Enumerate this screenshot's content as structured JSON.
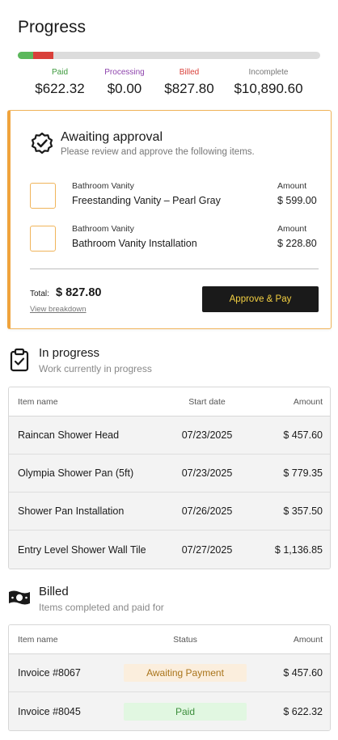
{
  "page": {
    "title": "Progress"
  },
  "progress": {
    "paid_fraction": 0.0505,
    "billed_fraction": 0.0672,
    "colors": {
      "paid": "#5cb85c",
      "billed": "#d9403a",
      "track": "#dcdcdc"
    },
    "stats": [
      {
        "label": "Paid",
        "value": "$622.32",
        "color": "#3d9a3d"
      },
      {
        "label": "Processing",
        "value": "$0.00",
        "color": "#8e44ad"
      },
      {
        "label": "Billed",
        "value": "$827.80",
        "color": "#d9403a"
      },
      {
        "label": "Incomplete",
        "value": "$10,890.60",
        "color": "#777777"
      }
    ]
  },
  "approval": {
    "icon": "badge-check-icon",
    "title": "Awaiting approval",
    "subtitle": "Please review and approve the following items.",
    "items": [
      {
        "category": "Bathroom Vanity",
        "name": "Freestanding Vanity – Pearl Gray",
        "amount_label": "Amount",
        "amount": "$ 599.00"
      },
      {
        "category": "Bathroom Vanity",
        "name": "Bathroom Vanity Installation",
        "amount_label": "Amount",
        "amount": "$ 228.80"
      }
    ],
    "total_label": "Total:",
    "total_value": "$ 827.80",
    "breakdown_link": "View breakdown",
    "approve_button": "Approve & Pay",
    "accent_color": "#f0a33c"
  },
  "in_progress": {
    "icon": "clipboard-check-icon",
    "title": "In progress",
    "subtitle": "Work currently in progress",
    "columns": [
      "Item name",
      "Start date",
      "Amount"
    ],
    "rows": [
      {
        "name": "Raincan Shower Head",
        "date": "07/23/2025",
        "amount": "$ 457.60"
      },
      {
        "name": "Olympia Shower Pan (5ft)",
        "date": "07/23/2025",
        "amount": "$ 779.35"
      },
      {
        "name": "Shower Pan Installation",
        "date": "07/26/2025",
        "amount": "$ 357.50"
      },
      {
        "name": "Entry Level Shower Wall Tile",
        "date": "07/27/2025",
        "amount": "$ 1,136.85"
      }
    ]
  },
  "billed": {
    "icon": "cash-icon",
    "title": "Billed",
    "subtitle": "Items completed and paid for",
    "columns": [
      "Item name",
      "Status",
      "Amount"
    ],
    "rows": [
      {
        "name": "Invoice #8067",
        "status": "Awaiting Payment",
        "status_type": "awaiting",
        "amount": "$ 457.60"
      },
      {
        "name": "Invoice #8045",
        "status": "Paid",
        "status_type": "paid",
        "amount": "$ 622.32"
      }
    ]
  }
}
